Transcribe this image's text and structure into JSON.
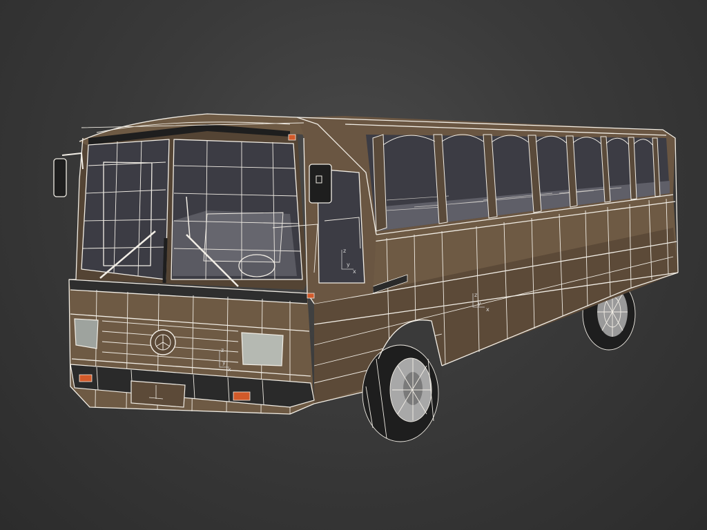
{
  "scene": {
    "subject": "bus",
    "render_mode": "shaded-wireframe",
    "colors": {
      "background_top": "#4a4a4a",
      "background_bottom": "#2c2c2c",
      "body_shell": "#6e5a44",
      "body_shadow": "#4f3f30",
      "wireframe": "#f2eee6",
      "glass": "#3e3e46",
      "interior": "#5a5a62",
      "bumper": "#2a2a2a",
      "tire": "#1e1e1e",
      "indicator_light": "#d25a2a"
    }
  },
  "axis_gizmos": [
    {
      "labels": [
        "z",
        "y",
        "x"
      ]
    },
    {
      "labels": [
        "z",
        "y",
        "x"
      ]
    },
    {
      "labels": [
        "z",
        "y",
        "x"
      ]
    }
  ]
}
